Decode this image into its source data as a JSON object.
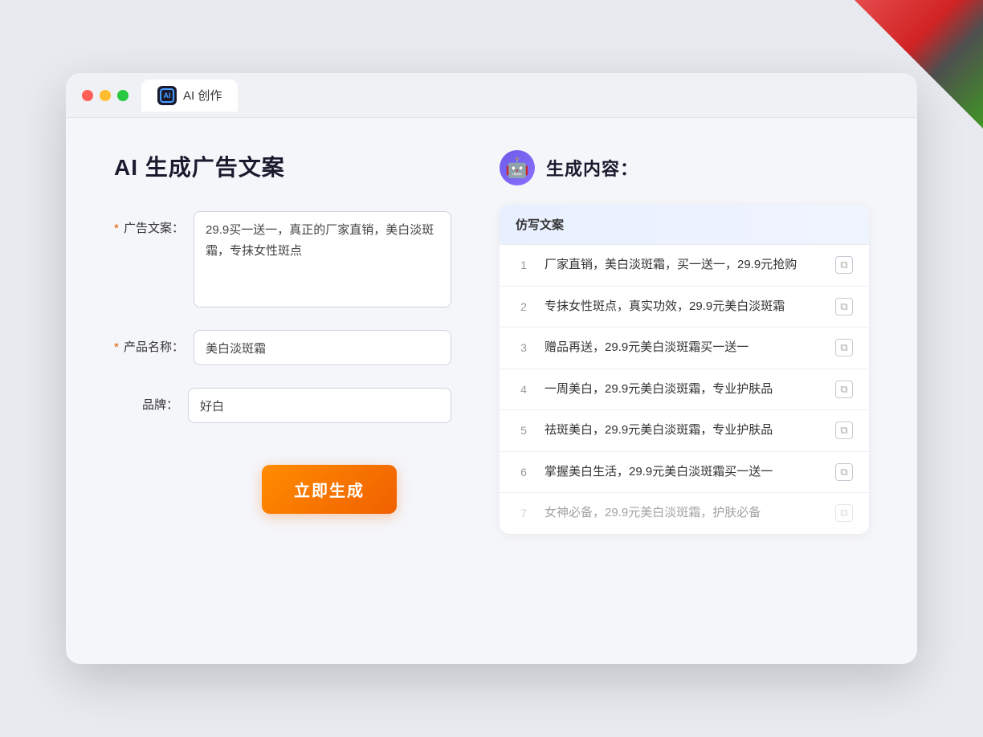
{
  "browser": {
    "tab_label": "AI 创作",
    "tab_icon": "AI"
  },
  "left_panel": {
    "title": "AI 生成广告文案",
    "fields": [
      {
        "id": "ad_copy",
        "label": "广告文案：",
        "required": true,
        "type": "textarea",
        "value": "29.9买一送一，真正的厂家直销，美白淡斑霜，专抹女性斑点"
      },
      {
        "id": "product_name",
        "label": "产品名称：",
        "required": true,
        "type": "input",
        "value": "美白淡斑霜"
      },
      {
        "id": "brand",
        "label": "品牌：",
        "required": false,
        "type": "input",
        "value": "好白"
      }
    ],
    "generate_button": "立即生成"
  },
  "right_panel": {
    "title": "生成内容：",
    "column_header": "仿写文案",
    "results": [
      {
        "num": 1,
        "text": "厂家直销，美白淡斑霜，买一送一，29.9元抢购"
      },
      {
        "num": 2,
        "text": "专抹女性斑点，真实功效，29.9元美白淡斑霜"
      },
      {
        "num": 3,
        "text": "赠品再送，29.9元美白淡斑霜买一送一"
      },
      {
        "num": 4,
        "text": "一周美白，29.9元美白淡斑霜，专业护肤品"
      },
      {
        "num": 5,
        "text": "祛斑美白，29.9元美白淡斑霜，专业护肤品"
      },
      {
        "num": 6,
        "text": "掌握美白生活，29.9元美白淡斑霜买一送一"
      },
      {
        "num": 7,
        "text": "女神必备，29.9元美白淡斑霜，护肤必备",
        "faded": true
      }
    ]
  }
}
